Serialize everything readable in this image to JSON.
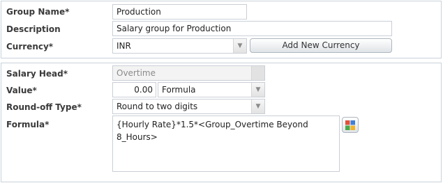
{
  "group": {
    "name_label": "Group Name*",
    "name_value": "Production",
    "description_label": "Description",
    "description_value": "Salary group for Production",
    "currency_label": "Currency*",
    "currency_value": "INR",
    "add_currency_button": "Add New Currency"
  },
  "salary": {
    "head_label": "Salary Head*",
    "head_value": "Overtime",
    "value_label": "Value*",
    "value_amount": "0.00",
    "value_type": "Formula",
    "roundoff_label": "Round-off Type*",
    "roundoff_value": "Round to two digits",
    "formula_label": "Formula*",
    "formula_value": "{Hourly Rate}*1.5*<Group_Overtime Beyond 8_Hours>",
    "formula_builder_icon": "formula-grid-icon"
  }
}
